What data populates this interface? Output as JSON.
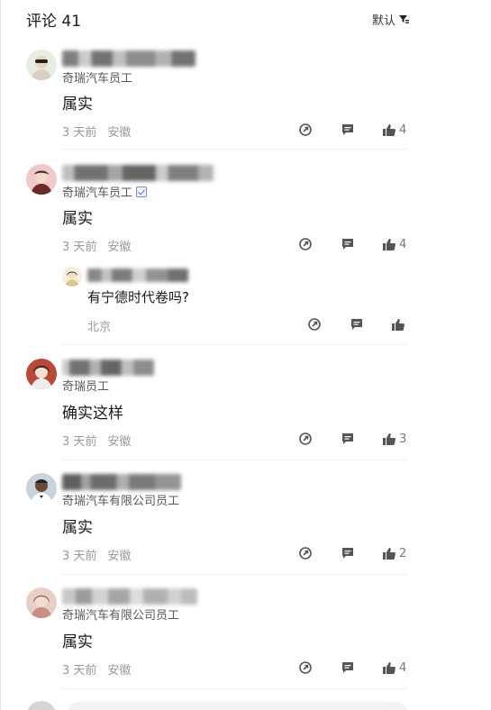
{
  "header": {
    "title": "评论 41",
    "sort_label": "默认"
  },
  "comments": [
    {
      "title": "奇瑞汽车员工",
      "verified": false,
      "text": "属实",
      "time": "3 天前",
      "location": "安徽",
      "likes": "4"
    },
    {
      "title": "奇瑞汽车员工",
      "verified": true,
      "text": "属实",
      "time": "3 天前",
      "location": "安徽",
      "likes": "4"
    },
    {
      "title": "奇瑞员工",
      "verified": false,
      "text": "确实这样",
      "time": "3 天前",
      "location": "安徽",
      "likes": "3"
    },
    {
      "title": "奇瑞汽车有限公司员工",
      "verified": false,
      "text": "属实",
      "time": "3 天前",
      "location": "安徽",
      "likes": "2"
    },
    {
      "title": "奇瑞汽车有限公司员工",
      "verified": false,
      "text": "属实",
      "time": "3 天前",
      "location": "安徽",
      "likes": "4"
    }
  ],
  "reply": {
    "text": "有宁德时代卷吗?",
    "location": "北京"
  },
  "icons": {
    "repost": "repost-icon",
    "comment": "comment-icon",
    "like": "thumbs-up-icon",
    "filter": "filter-icon"
  },
  "colors": {
    "icon": "#555555",
    "meta": "#9a9a9a",
    "text": "#1a1a1a"
  }
}
